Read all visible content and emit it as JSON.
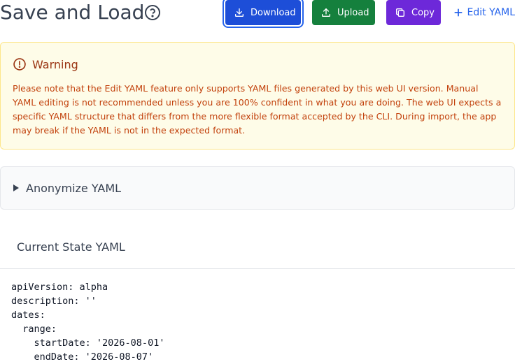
{
  "header": {
    "title": "Save and Load",
    "help_icon": "question-circle-icon",
    "buttons": {
      "download": "Download",
      "upload": "Upload",
      "copy": "Copy",
      "edit_yaml": "Edit YAML"
    }
  },
  "warning": {
    "title": "Warning",
    "text": "Please note that the Edit YAML feature only supports YAML files generated by this web UI version. Manual YAML editing is not recommended unless you are 100% confident in what you are doing. The web UI expects a specific YAML structure that differs from the more flexible format accepted by the CLI. During import, the app may break if the YAML is not in the expected format."
  },
  "anonymize": {
    "label": "Anonymize YAML"
  },
  "current_state": {
    "title": "Current State YAML",
    "lines": [
      "apiVersion: alpha",
      "description: ''",
      "dates:",
      "  range:",
      "    startDate: '2026-08-01'",
      "    endDate: '2026-08-07'"
    ]
  },
  "colors": {
    "download": "#1d4ed8",
    "upload": "#15803d",
    "copy": "#6d28d9",
    "link": "#2563eb",
    "warning_bg": "#fefce8",
    "warning_text": "#c2410c"
  }
}
